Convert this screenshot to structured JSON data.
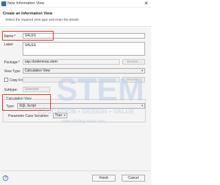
{
  "window": {
    "title": "New Information View",
    "close_glyph": "✕"
  },
  "header": {
    "title": "Create an Information View",
    "description": "Select the required view type and enter the details"
  },
  "form": {
    "name_label": "Name:*",
    "name_value": "SALES",
    "label_label": "Label:",
    "label_value": "SALES",
    "package_label": "Package:*",
    "package_value": "sap.cbodemoau.stem",
    "browse_label": "Browse...",
    "view_type_label": "View Type:",
    "view_type_value": "Calculation View",
    "copy_from_label": "Copy From:",
    "subtype_label": "Subtype:",
    "subtype_value": "Standard",
    "calc_view_group": "Calculation View",
    "type_label": "Type:",
    "type_value": "SQL Script",
    "param_label": "Parameter Case Sensitive:",
    "param_value": "True"
  },
  "watermark": {
    "brand": "STEM",
    "tagline": "EDUCATION • DESIGN • VALUE",
    "url": "www.sterling-team.com"
  },
  "footer": {
    "help_glyph": "?",
    "finish_label": "Finish",
    "cancel_label": "Cancel"
  },
  "colors": {
    "highlight": "#e0302c",
    "accent": "#3a6ea5"
  }
}
